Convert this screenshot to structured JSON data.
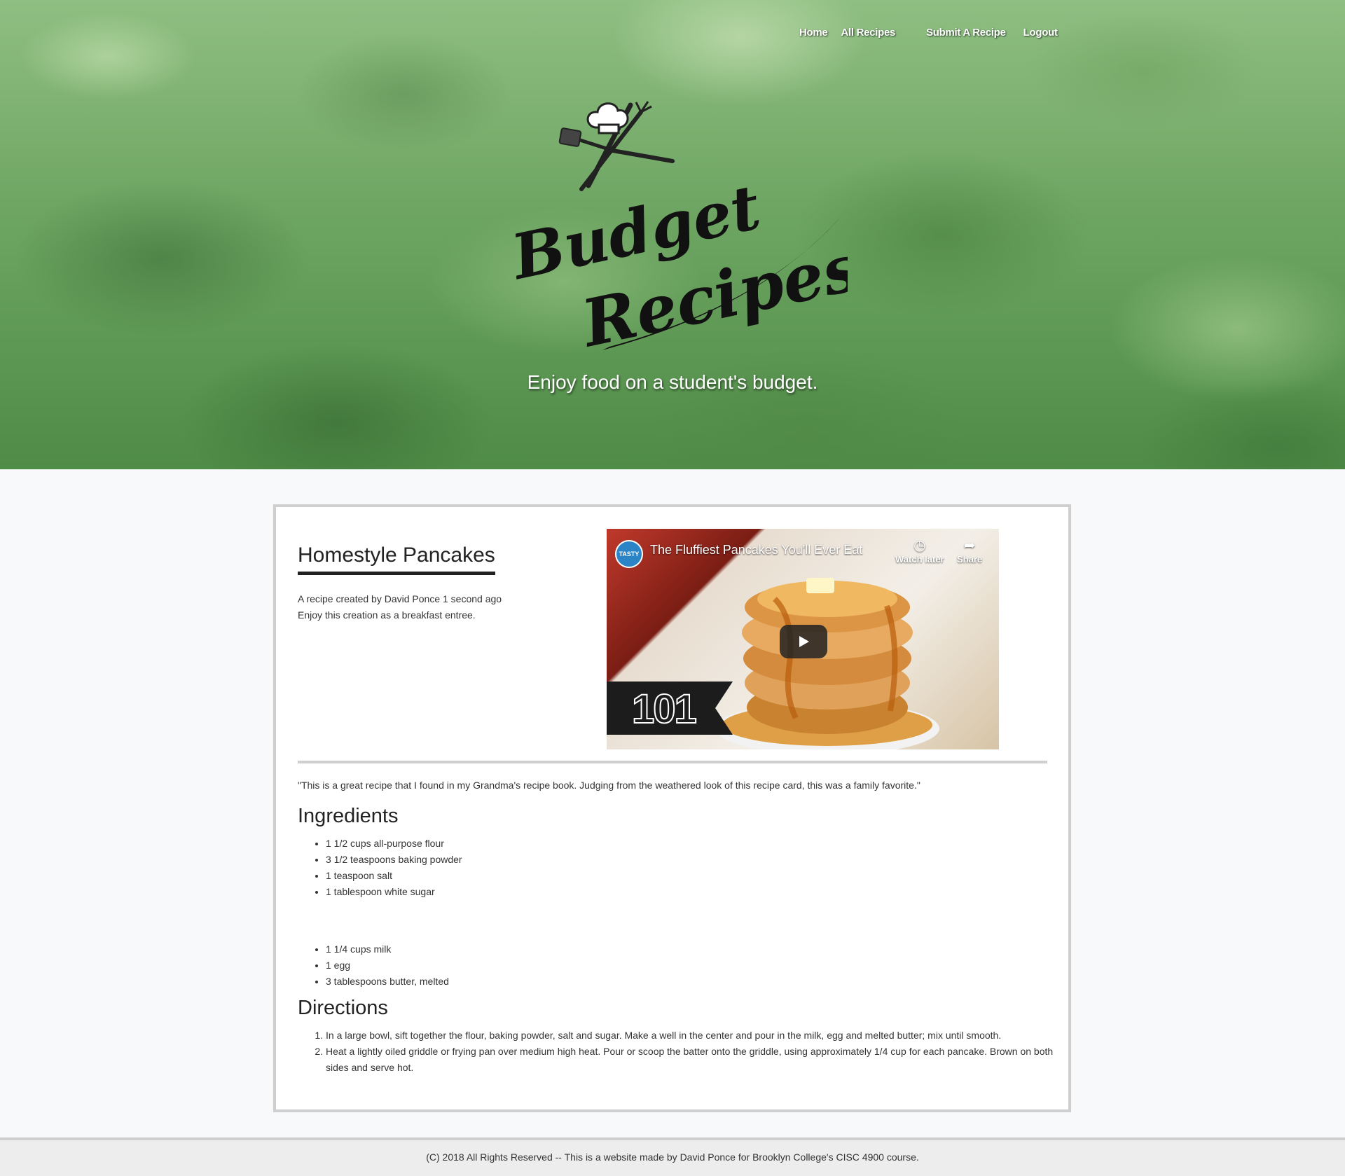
{
  "nav": {
    "items": [
      {
        "label": "Home"
      },
      {
        "label": "All Recipes"
      },
      {
        "label": "Submit A Recipe"
      },
      {
        "label": "Logout"
      }
    ]
  },
  "hero": {
    "logo_line1": "Budget",
    "logo_line2": "Recipes",
    "tagline": "Enjoy food on a student's budget."
  },
  "recipe": {
    "title": "Homestyle Pancakes",
    "meta_line1": "A recipe created by David Ponce 1 second ago",
    "meta_line2": "Enjoy this creation as a breakfast entree.",
    "quote": "\"This is a great recipe that I found in my Grandma's recipe book. Judging from the weathered look of this recipe card, this was a family favorite.\"",
    "ingredients_title": "Ingredients",
    "ingredients_group1": [
      "1 1/2 cups all-purpose flour",
      "3 1/2 teaspoons baking powder",
      "1 teaspoon salt",
      "1 tablespoon white sugar"
    ],
    "ingredients_group2": [
      "1 1/4 cups milk",
      "1 egg",
      "3 tablespoons butter, melted"
    ],
    "directions_title": "Directions",
    "directions": [
      "In a large bowl, sift together the flour, baking powder, salt and sugar. Make a well in the center and pour in the milk, egg and melted butter; mix until smooth.",
      "Heat a lightly oiled griddle or frying pan over medium high heat. Pour or scoop the batter onto the griddle, using approximately 1/4 cup for each pancake. Brown on both sides and serve hot."
    ]
  },
  "video": {
    "title": "The Fluffiest Pancakes You'll Ever Eat",
    "channel": "TASTY",
    "watch_later": "Watch later",
    "share": "Share",
    "badge": "101"
  },
  "footer": {
    "text": "(C) 2018 All Rights Reserved -- This is a website made by David Ponce for Brooklyn College's CISC 4900 course."
  }
}
